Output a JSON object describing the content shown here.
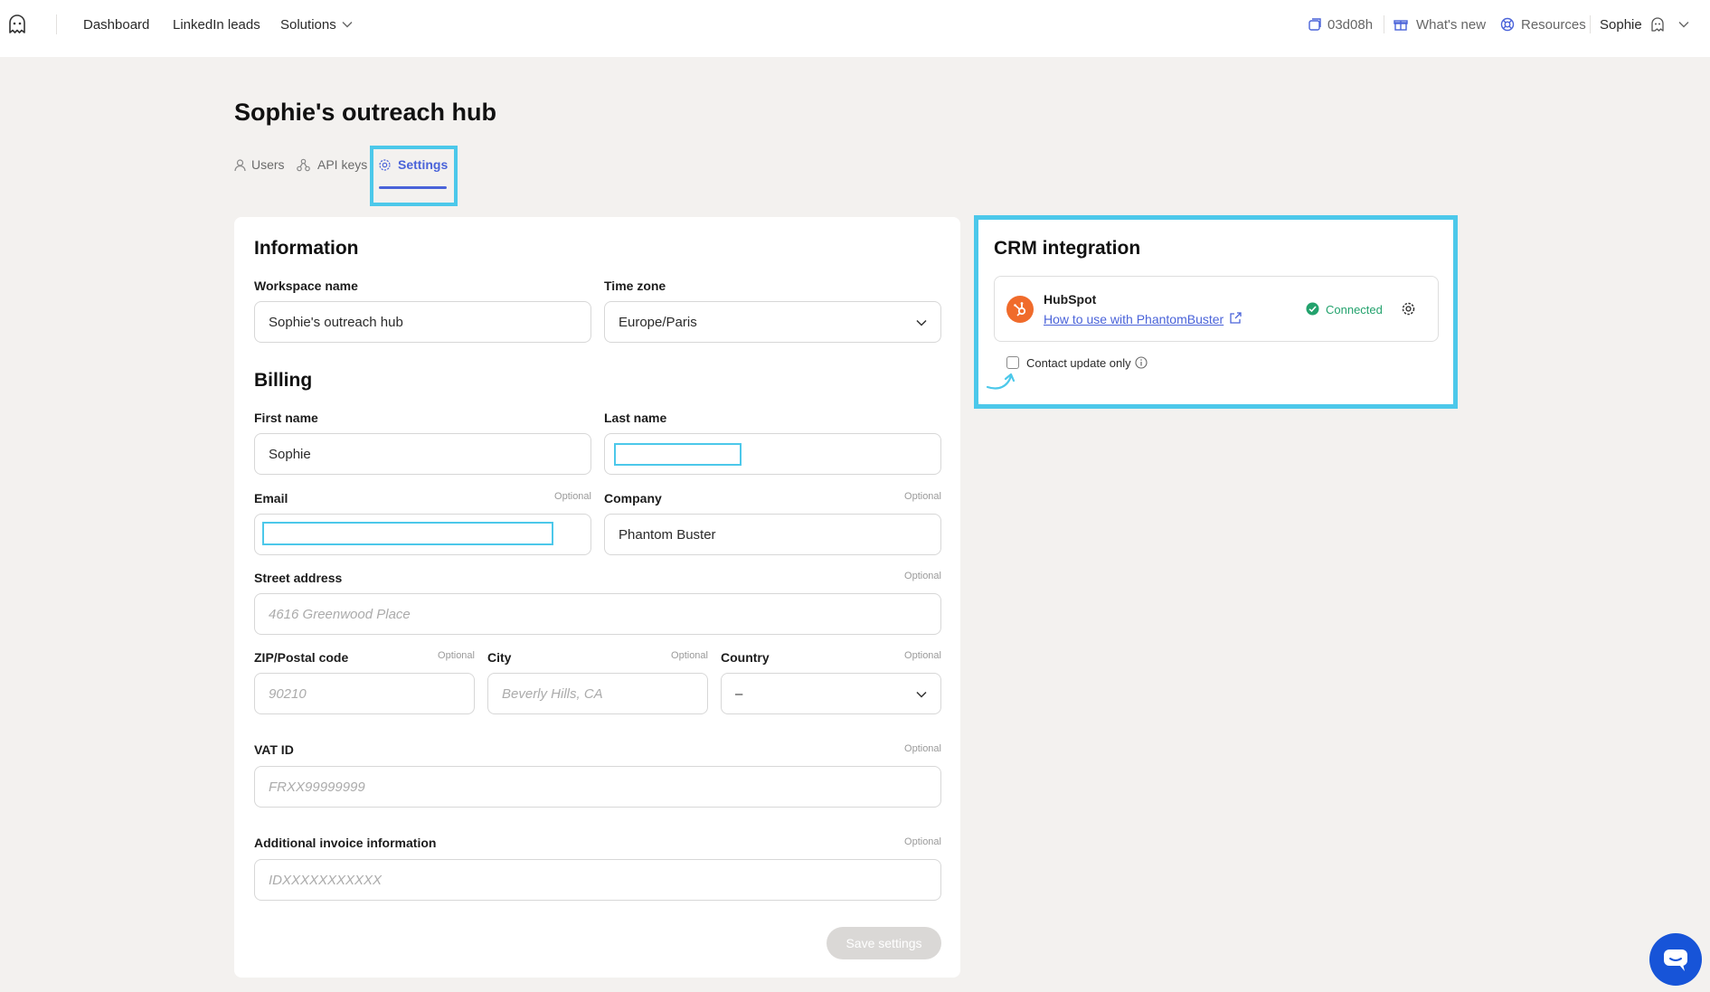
{
  "nav": {
    "logo_icon": "ghost-logo-icon",
    "dashboard": "Dashboard",
    "linkedin_leads": "LinkedIn leads",
    "solutions": "Solutions",
    "time_remaining": "03d08h",
    "whats_new": "What's new",
    "resources": "Resources",
    "user_name": "Sophie"
  },
  "page": {
    "title": "Sophie's outreach hub"
  },
  "tabs": [
    {
      "label": "Users",
      "icon": "user-icon"
    },
    {
      "label": "API keys",
      "icon": "api-key-icon"
    },
    {
      "label": "Settings",
      "icon": "gear-icon",
      "active": true
    }
  ],
  "information": {
    "title": "Information",
    "workspace_name_label": "Workspace name",
    "workspace_name_value": "Sophie's outreach hub",
    "time_zone_label": "Time zone",
    "time_zone_value": "Europe/Paris"
  },
  "billing": {
    "title": "Billing",
    "first_name_label": "First name",
    "first_name_value": "Sophie",
    "last_name_label": "Last name",
    "last_name_value": "",
    "email_label": "Email",
    "email_optional": "Optional",
    "email_value": "",
    "company_label": "Company",
    "company_optional": "Optional",
    "company_value": "Phantom Buster",
    "street_label": "Street address",
    "street_optional": "Optional",
    "street_placeholder": "4616 Greenwood Place",
    "zip_label": "ZIP/Postal code",
    "zip_optional": "Optional",
    "zip_placeholder": "90210",
    "city_label": "City",
    "city_optional": "Optional",
    "city_placeholder": "Beverly Hills, CA",
    "country_label": "Country",
    "country_optional": "Optional",
    "country_value": "–",
    "vat_label": "VAT ID",
    "vat_optional": "Optional",
    "vat_placeholder": "FRXX99999999",
    "invoice_label": "Additional invoice information",
    "invoice_optional": "Optional",
    "invoice_placeholder": "IDXXXXXXXXXXX",
    "save_label": "Save settings"
  },
  "crm": {
    "title": "CRM integration",
    "provider": "HubSpot",
    "help_link": "How to use with PhantomBuster",
    "status": "Connected",
    "contact_update_label": "Contact update only",
    "contact_update_checked": false
  },
  "colors": {
    "accent": "#4a63d9",
    "highlight": "#4cc8ea",
    "connected": "#23a26d",
    "hubspot": "#f06b2b",
    "chat": "#1754d8"
  }
}
